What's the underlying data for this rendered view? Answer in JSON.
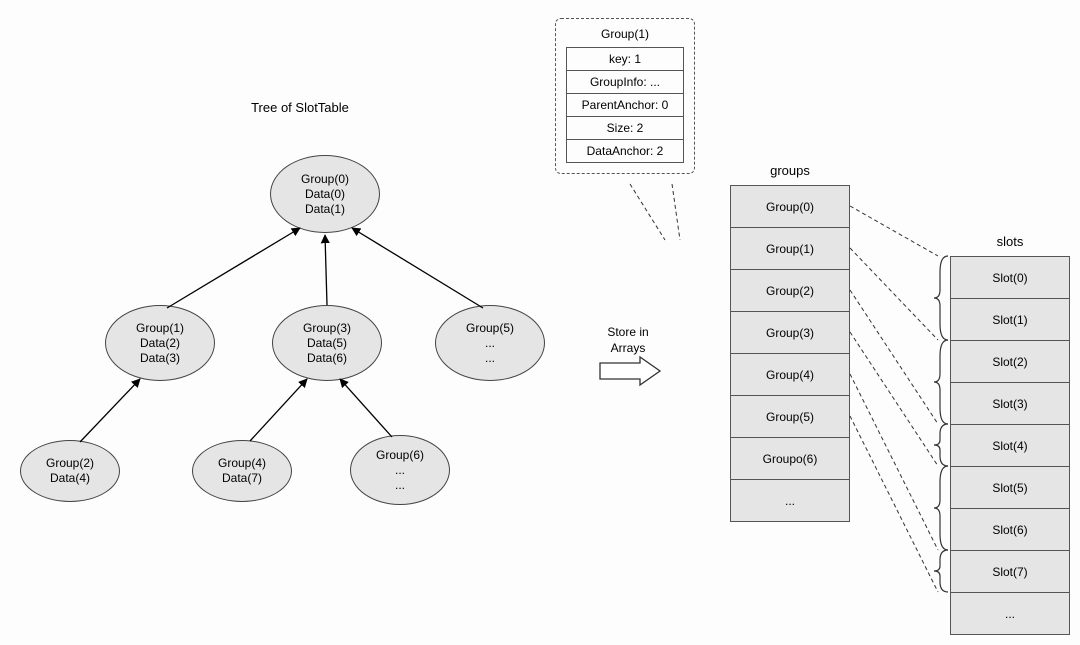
{
  "tree_title": "Tree of SlotTable",
  "nodes": {
    "root": {
      "lines": [
        "Group(0)",
        "Data(0)",
        "Data(1)"
      ]
    },
    "n1": {
      "lines": [
        "Group(1)",
        "Data(2)",
        "Data(3)"
      ]
    },
    "n3": {
      "lines": [
        "Group(3)",
        "Data(5)",
        "Data(6)"
      ]
    },
    "n5": {
      "lines": [
        "Group(5)",
        "...",
        "..."
      ]
    },
    "n2": {
      "lines": [
        "Group(2)",
        "Data(4)"
      ]
    },
    "n4": {
      "lines": [
        "Group(4)",
        "Data(7)"
      ]
    },
    "n6": {
      "lines": [
        "Group(6)",
        "...",
        "..."
      ]
    }
  },
  "callout": {
    "title": "Group(1)",
    "rows": [
      "key: 1",
      "GroupInfo: ...",
      "ParentAnchor: 0",
      "Size: 2",
      "DataAnchor: 2"
    ]
  },
  "store_label_line1": "Store in",
  "store_label_line2": "Arrays",
  "groups_title": "groups",
  "groups_rows": [
    "Group(0)",
    "Group(1)",
    "Group(2)",
    "Group(3)",
    "Group(4)",
    "Group(5)",
    "Groupo(6)",
    "..."
  ],
  "slots_title": "slots",
  "slots_rows": [
    "Slot(0)",
    "Slot(1)",
    "Slot(2)",
    "Slot(3)",
    "Slot(4)",
    "Slot(5)",
    "Slot(6)",
    "Slot(7)",
    "..."
  ]
}
